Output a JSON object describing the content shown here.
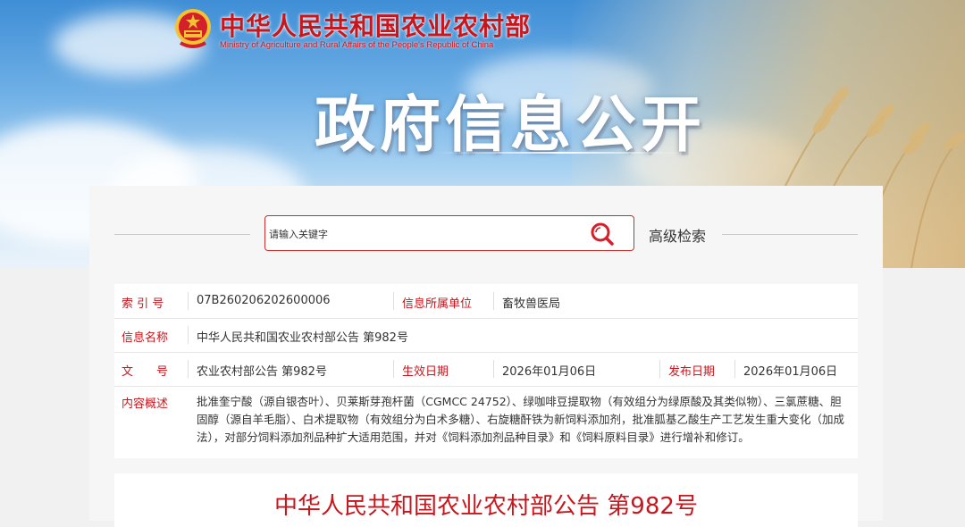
{
  "header": {
    "ministry_cn": "中华人民共和国农业农村部",
    "ministry_en": "Ministry of Agriculture and Rural Affairs of the People's Republic of China",
    "banner_title": "政府信息公开",
    "brand_color": "#c8161d",
    "emblem_icon": "national-emblem-icon"
  },
  "search": {
    "placeholder": "请输入关键字",
    "icon": "search-icon",
    "advanced_label": "高级检索"
  },
  "info": {
    "index_label": "索 引 号",
    "index_value": "07B260206202600006",
    "org_label": "信息所属单位",
    "org_value": "畜牧兽医局",
    "name_label": "信息名称",
    "name_value": "中华人民共和国农业农村部公告 第982号",
    "doc_label": "文　　号",
    "doc_value": "农业农村部公告 第982号",
    "effective_label": "生效日期",
    "effective_value": "2026年01月06日",
    "publish_label": "发布日期",
    "publish_value": "2026年01月06日",
    "summary_label": "内容概述",
    "summary_value": "批准奎宁酸（源自银杏叶）、贝莱斯芽孢杆菌（CGMCC 24752）、绿咖啡豆提取物（有效组分为绿原酸及其类似物）、三氯蔗糖、胆固醇（源自羊毛脂）、白术提取物（有效组分为白术多糖）、右旋糖酐铁为新饲料添加剂，批准胍基乙酸生产工艺发生重大变化（加成法），对部分饲料添加剂品种扩大适用范围，并对《饲料添加剂品种目录》和《饲料原料目录》进行增补和修订。"
  },
  "document": {
    "title": "中华人民共和国农业农村部公告 第982号"
  }
}
